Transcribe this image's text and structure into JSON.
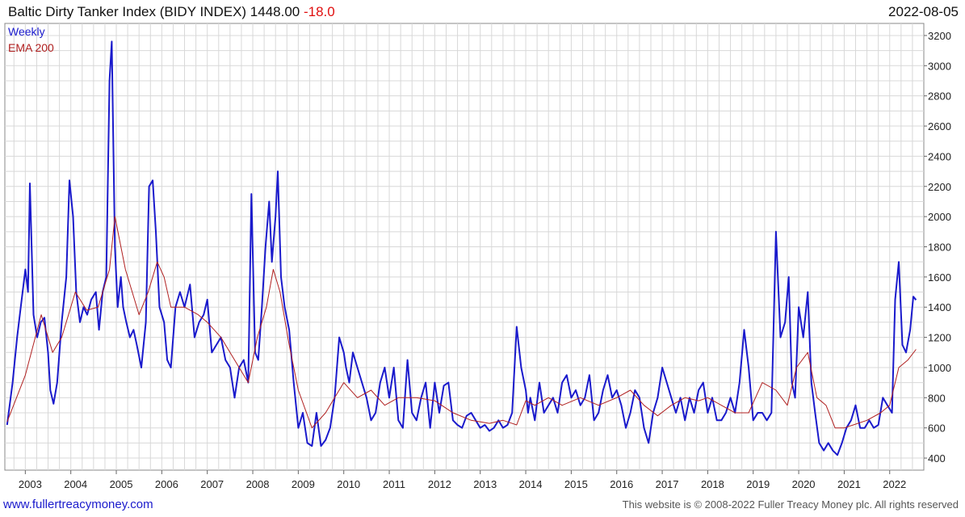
{
  "header": {
    "title": "Baltic Dirty Tanker Index (BIDY INDEX) 1448.00",
    "change": "-18.0",
    "date": "2022-08-05"
  },
  "legend": {
    "weekly": "Weekly",
    "ema": "EMA 200"
  },
  "footer": {
    "left": "www.fullertreacymoney.com",
    "right": "This website is © 2008-2022 Fuller Treacy Money plc. All rights reserved"
  },
  "colors": {
    "series": "#1a1acc",
    "ema": "#b02020",
    "grid": "#d8d8d8",
    "change": "#e01010"
  },
  "chart_data": {
    "type": "line",
    "title": "Baltic Dirty Tanker Index (BIDY INDEX)",
    "ylim": [
      320,
      3280
    ],
    "xlim": [
      2002.55,
      2022.75
    ],
    "y_ticks": [
      400,
      600,
      800,
      1000,
      1200,
      1400,
      1600,
      1800,
      2000,
      2200,
      2400,
      2600,
      2800,
      3000,
      3200
    ],
    "x_ticks": [
      2003,
      2004,
      2005,
      2006,
      2007,
      2008,
      2009,
      2010,
      2011,
      2012,
      2013,
      2014,
      2015,
      2016,
      2017,
      2018,
      2019,
      2020,
      2021,
      2022
    ],
    "grid": true,
    "y_axis_side": "right",
    "legend_position": "top-left",
    "series": [
      {
        "name": "Weekly",
        "x": [
          2002.6,
          2002.72,
          2002.82,
          2002.9,
          2003.0,
          2003.06,
          2003.1,
          2003.18,
          2003.26,
          2003.34,
          2003.42,
          2003.5,
          2003.55,
          2003.62,
          2003.7,
          2003.8,
          2003.9,
          2003.97,
          2004.05,
          2004.12,
          2004.2,
          2004.28,
          2004.36,
          2004.45,
          2004.55,
          2004.62,
          2004.7,
          2004.78,
          2004.85,
          2004.9,
          2004.97,
          2005.03,
          2005.1,
          2005.15,
          2005.22,
          2005.3,
          2005.38,
          2005.45,
          2005.55,
          2005.65,
          2005.72,
          2005.8,
          2005.87,
          2005.95,
          2006.05,
          2006.12,
          2006.2,
          2006.3,
          2006.4,
          2006.5,
          2006.62,
          2006.72,
          2006.82,
          2006.92,
          2007.0,
          2007.1,
          2007.2,
          2007.3,
          2007.4,
          2007.5,
          2007.6,
          2007.7,
          2007.8,
          2007.9,
          2007.97,
          2008.05,
          2008.12,
          2008.2,
          2008.28,
          2008.36,
          2008.42,
          2008.5,
          2008.55,
          2008.62,
          2008.7,
          2008.8,
          2008.9,
          2009.0,
          2009.1,
          2009.2,
          2009.3,
          2009.4,
          2009.5,
          2009.6,
          2009.7,
          2009.8,
          2009.9,
          2010.0,
          2010.05,
          2010.12,
          2010.2,
          2010.3,
          2010.4,
          2010.5,
          2010.6,
          2010.7,
          2010.8,
          2010.9,
          2011.0,
          2011.1,
          2011.2,
          2011.3,
          2011.4,
          2011.5,
          2011.6,
          2011.7,
          2011.8,
          2011.9,
          2012.0,
          2012.1,
          2012.2,
          2012.3,
          2012.4,
          2012.5,
          2012.6,
          2012.7,
          2012.8,
          2012.9,
          2013.0,
          2013.1,
          2013.2,
          2013.3,
          2013.4,
          2013.5,
          2013.6,
          2013.7,
          2013.8,
          2013.9,
          2014.0,
          2014.05,
          2014.1,
          2014.2,
          2014.3,
          2014.4,
          2014.5,
          2014.6,
          2014.7,
          2014.8,
          2014.9,
          2015.0,
          2015.1,
          2015.2,
          2015.3,
          2015.4,
          2015.5,
          2015.6,
          2015.7,
          2015.8,
          2015.9,
          2016.0,
          2016.1,
          2016.2,
          2016.3,
          2016.4,
          2016.5,
          2016.6,
          2016.7,
          2016.8,
          2016.9,
          2017.0,
          2017.1,
          2017.2,
          2017.3,
          2017.4,
          2017.5,
          2017.6,
          2017.7,
          2017.8,
          2017.9,
          2018.0,
          2018.1,
          2018.2,
          2018.3,
          2018.4,
          2018.5,
          2018.6,
          2018.7,
          2018.8,
          2018.9,
          2019.0,
          2019.1,
          2019.2,
          2019.3,
          2019.4,
          2019.5,
          2019.6,
          2019.7,
          2019.78,
          2019.85,
          2019.92,
          2020.0,
          2020.1,
          2020.2,
          2020.28,
          2020.36,
          2020.45,
          2020.55,
          2020.65,
          2020.75,
          2020.85,
          2020.95,
          2021.05,
          2021.15,
          2021.25,
          2021.35,
          2021.45,
          2021.55,
          2021.65,
          2021.75,
          2021.85,
          2021.95,
          2022.05,
          2022.12,
          2022.2,
          2022.28,
          2022.36,
          2022.45,
          2022.52,
          2022.58
        ],
        "values": [
          620,
          900,
          1200,
          1400,
          1650,
          1500,
          2220,
          1350,
          1200,
          1300,
          1330,
          1100,
          850,
          760,
          900,
          1300,
          1600,
          2240,
          2000,
          1500,
          1300,
          1400,
          1350,
          1450,
          1500,
          1250,
          1500,
          1600,
          2900,
          3160,
          1800,
          1400,
          1600,
          1400,
          1300,
          1200,
          1250,
          1150,
          1000,
          1300,
          2200,
          2240,
          1900,
          1400,
          1300,
          1050,
          1000,
          1400,
          1500,
          1400,
          1550,
          1200,
          1300,
          1350,
          1450,
          1100,
          1150,
          1200,
          1050,
          1000,
          800,
          1000,
          1050,
          900,
          2150,
          1100,
          1050,
          1400,
          1800,
          2100,
          1700,
          2000,
          2300,
          1600,
          1400,
          1250,
          900,
          600,
          700,
          500,
          480,
          700,
          480,
          520,
          600,
          800,
          1200,
          1100,
          1000,
          900,
          1100,
          1000,
          900,
          800,
          650,
          700,
          900,
          1000,
          800,
          1000,
          650,
          600,
          1050,
          700,
          650,
          800,
          900,
          600,
          900,
          700,
          880,
          900,
          650,
          620,
          600,
          680,
          700,
          650,
          600,
          620,
          580,
          600,
          650,
          600,
          620,
          700,
          1270,
          1000,
          850,
          700,
          800,
          650,
          900,
          700,
          750,
          800,
          700,
          900,
          950,
          800,
          850,
          750,
          800,
          950,
          650,
          700,
          850,
          950,
          800,
          850,
          750,
          600,
          700,
          850,
          800,
          600,
          500,
          700,
          800,
          1000,
          900,
          800,
          700,
          800,
          650,
          800,
          700,
          850,
          900,
          700,
          800,
          650,
          650,
          700,
          800,
          700,
          900,
          1250,
          1000,
          650,
          700,
          700,
          650,
          700,
          1900,
          1200,
          1300,
          1600,
          900,
          800,
          1400,
          1200,
          1500,
          900,
          700,
          500,
          450,
          500,
          450,
          420,
          500,
          600,
          650,
          750,
          600,
          600,
          650,
          600,
          620,
          800,
          750,
          700,
          1450,
          1700,
          1150,
          1100,
          1250,
          1470,
          1448
        ]
      },
      {
        "name": "EMA 200",
        "x": [
          2002.6,
          2003.0,
          2003.35,
          2003.6,
          2003.8,
          2004.1,
          2004.35,
          2004.6,
          2004.85,
          2004.97,
          2005.2,
          2005.5,
          2005.7,
          2005.9,
          2006.05,
          2006.2,
          2006.5,
          2006.8,
          2007.0,
          2007.3,
          2007.6,
          2007.9,
          2008.1,
          2008.3,
          2008.45,
          2008.6,
          2008.8,
          2009.0,
          2009.3,
          2009.6,
          2009.8,
          2010.0,
          2010.3,
          2010.6,
          2010.9,
          2011.2,
          2011.6,
          2012.0,
          2012.4,
          2012.8,
          2013.2,
          2013.5,
          2013.8,
          2014.0,
          2014.2,
          2014.5,
          2014.8,
          2015.2,
          2015.6,
          2016.0,
          2016.3,
          2016.6,
          2016.9,
          2017.2,
          2017.5,
          2017.8,
          2018.0,
          2018.3,
          2018.6,
          2018.9,
          2019.2,
          2019.5,
          2019.75,
          2019.95,
          2020.2,
          2020.4,
          2020.6,
          2020.8,
          2021.0,
          2021.2,
          2021.5,
          2021.8,
          2022.0,
          2022.2,
          2022.4,
          2022.58
        ],
        "values": [
          640,
          950,
          1350,
          1100,
          1200,
          1500,
          1380,
          1400,
          1650,
          2000,
          1650,
          1350,
          1500,
          1700,
          1600,
          1400,
          1400,
          1350,
          1300,
          1200,
          1050,
          900,
          1200,
          1400,
          1650,
          1500,
          1150,
          850,
          600,
          700,
          800,
          900,
          800,
          850,
          750,
          800,
          800,
          780,
          700,
          650,
          630,
          650,
          620,
          780,
          750,
          800,
          750,
          800,
          750,
          800,
          850,
          750,
          680,
          750,
          800,
          780,
          800,
          750,
          700,
          700,
          900,
          850,
          750,
          1000,
          1100,
          800,
          750,
          600,
          600,
          620,
          650,
          700,
          750,
          1000,
          1050,
          1120
        ]
      }
    ]
  }
}
